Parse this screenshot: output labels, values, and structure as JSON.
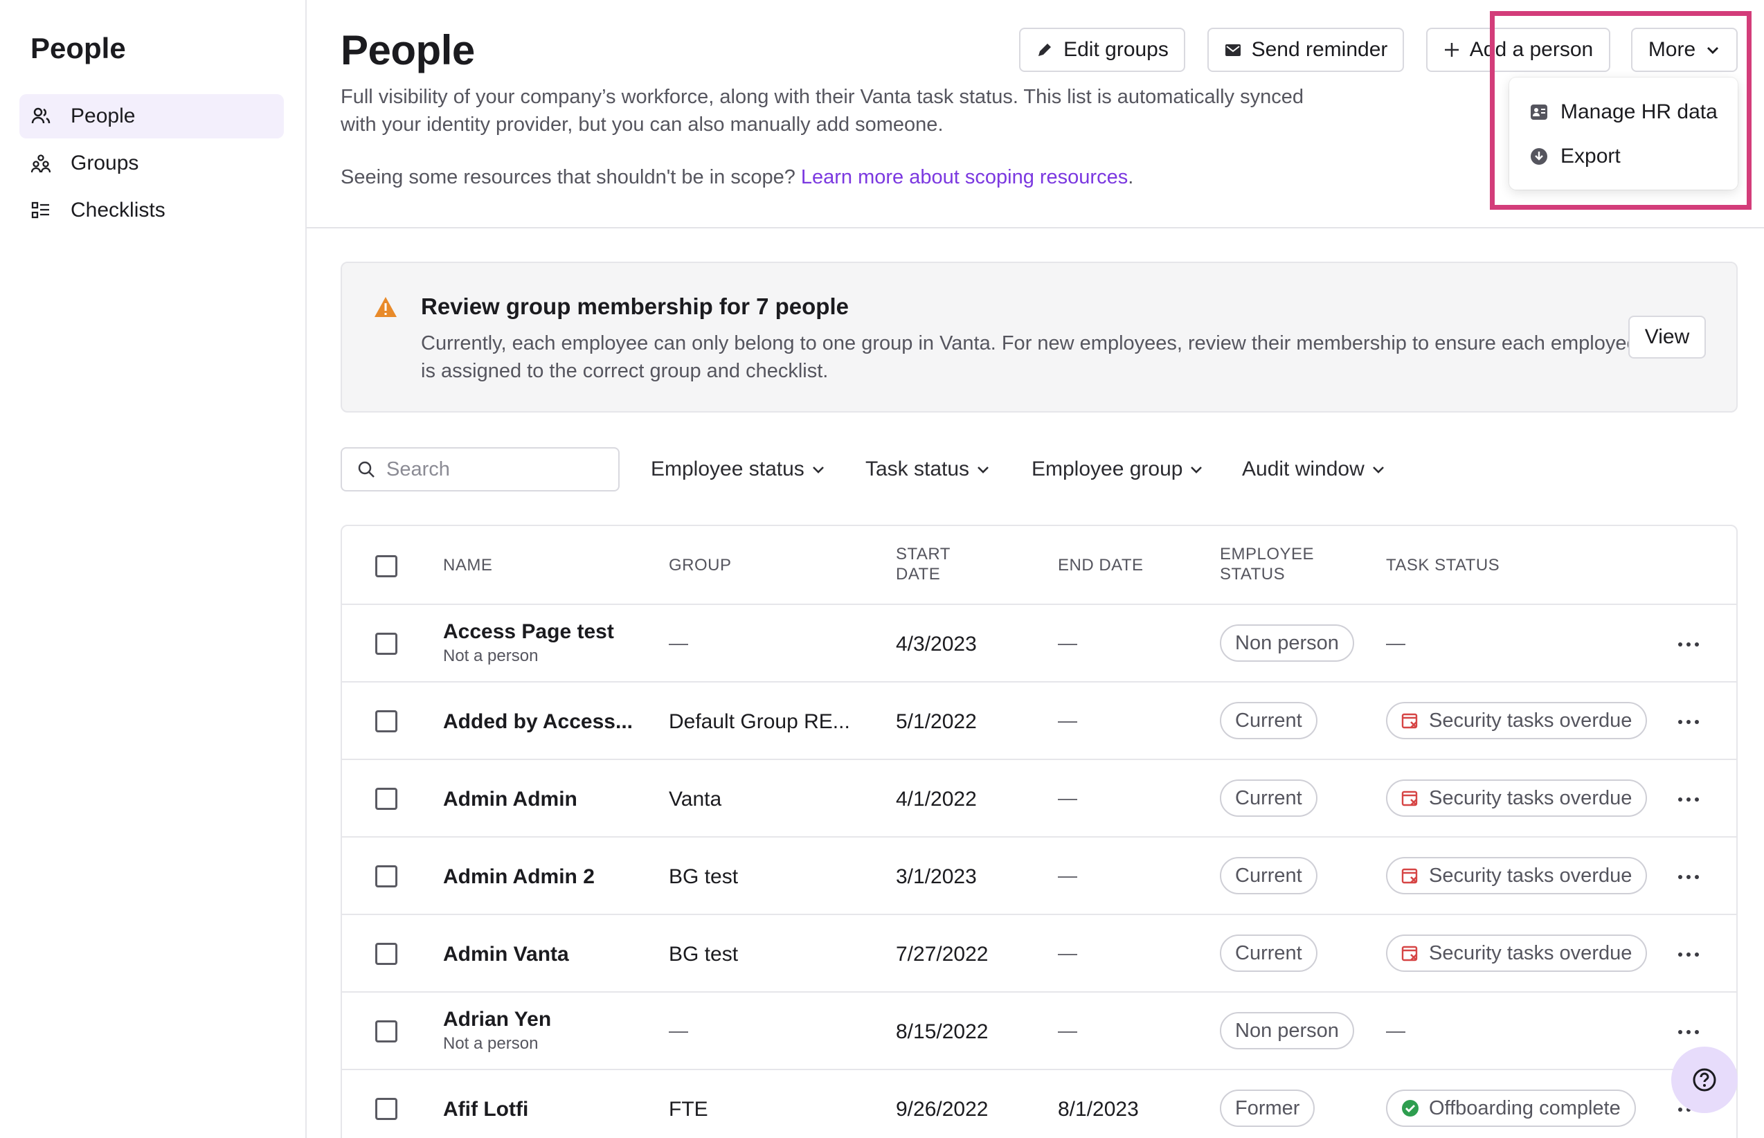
{
  "sidebar": {
    "title": "People",
    "items": [
      {
        "label": "People",
        "icon": "people-icon",
        "active": true
      },
      {
        "label": "Groups",
        "icon": "groups-icon",
        "active": false
      },
      {
        "label": "Checklists",
        "icon": "checklist-icon",
        "active": false
      }
    ]
  },
  "header": {
    "title": "People",
    "description": "Full visibility of your company’s workforce, along with their Vanta task status. This list is automatically synced with your identity provider, but you can also manually add someone.",
    "scope_text": "Seeing some resources that shouldn't be in scope? ",
    "scope_link": "Learn more about scoping resources",
    "scope_end": ".",
    "buttons": {
      "edit_groups": "Edit groups",
      "send_reminder": "Send reminder",
      "add_person": "Add a person",
      "more": "More"
    }
  },
  "more_menu": {
    "items": [
      {
        "label": "Manage HR data",
        "icon": "hr-data-icon"
      },
      {
        "label": "Export",
        "icon": "download-icon"
      }
    ]
  },
  "banner": {
    "title": "Review group membership for 7 people",
    "text": "Currently, each employee can only belong to one group in Vanta. For new employees, review their membership to ensure each employee is assigned to the correct group and checklist.",
    "button": "View"
  },
  "filters": {
    "search_placeholder": "Search",
    "employee_status": "Employee status",
    "task_status": "Task status",
    "employee_group": "Employee group",
    "audit_window": "Audit window"
  },
  "table": {
    "columns": {
      "name": "NAME",
      "group": "GROUP",
      "start_date_1": "START",
      "start_date_2": "DATE",
      "end_date": "END DATE",
      "employee_status_1": "EMPLOYEE",
      "employee_status_2": "STATUS",
      "task_status": "TASK STATUS"
    },
    "rows": [
      {
        "name": "Access Page test",
        "sub": "Not a person",
        "group": "",
        "start": "4/3/2023",
        "end": "",
        "status": "Non person",
        "task": ""
      },
      {
        "name": "Added by Access...",
        "sub": "",
        "group": "Default Group RE...",
        "start": "5/1/2022",
        "end": "",
        "status": "Current",
        "task": "Security tasks overdue"
      },
      {
        "name": "Admin Admin",
        "sub": "",
        "group": "Vanta",
        "start": "4/1/2022",
        "end": "",
        "status": "Current",
        "task": "Security tasks overdue"
      },
      {
        "name": "Admin Admin 2",
        "sub": "",
        "group": "BG test",
        "start": "3/1/2023",
        "end": "",
        "status": "Current",
        "task": "Security tasks overdue"
      },
      {
        "name": "Admin Vanta",
        "sub": "",
        "group": "BG test",
        "start": "7/27/2022",
        "end": "",
        "status": "Current",
        "task": "Security tasks overdue"
      },
      {
        "name": "Adrian Yen",
        "sub": "Not a person",
        "group": "",
        "start": "8/15/2022",
        "end": "",
        "status": "Non person",
        "task": ""
      },
      {
        "name": "Afif Lotfi",
        "sub": "",
        "group": "FTE",
        "start": "9/26/2022",
        "end": "8/1/2023",
        "status": "Former",
        "task": "Offboarding complete"
      }
    ]
  },
  "colors": {
    "accent": "#7b38e0",
    "highlight": "#d33d7a",
    "warning": "#e88a2a",
    "overdue": "#d64545",
    "complete": "#2e9e4f"
  }
}
